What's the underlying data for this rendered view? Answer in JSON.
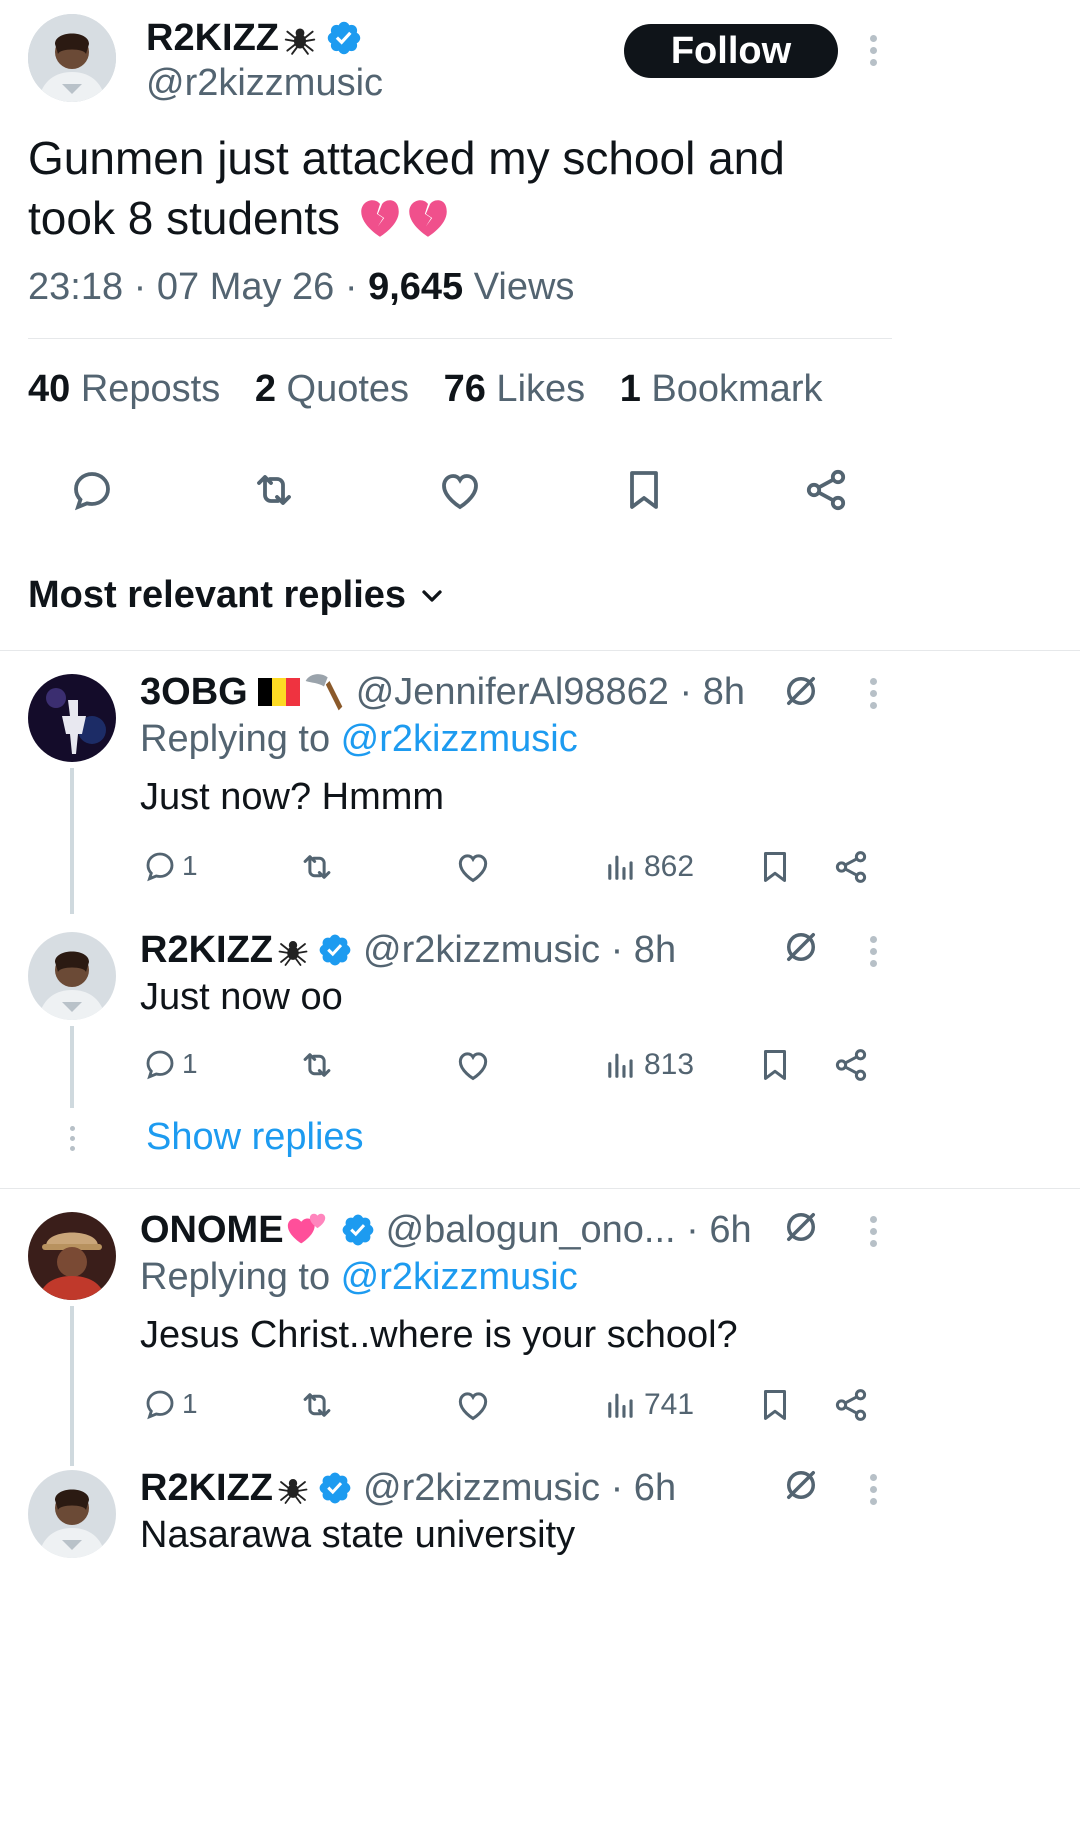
{
  "main_tweet": {
    "author_name": "R2KIZZ",
    "author_handle": "@r2kizzmusic",
    "follow_label": "Follow",
    "text_line1": "Gunmen just attacked my school and",
    "text_line2": "took 8 students",
    "emoji": "💔💔",
    "time": "23:18 · 07 May 26 · ",
    "views_count": "9,645",
    "views_label": " Views",
    "stats": {
      "reposts_num": "40",
      "reposts_label": " Reposts",
      "quotes_num": "2",
      "quotes_label": " Quotes",
      "likes_num": "76",
      "likes_label": " Likes",
      "bookmarks_num": "1",
      "bookmarks_label": " Bookmark"
    }
  },
  "replies_sort_label": "Most relevant replies",
  "replies": [
    {
      "name": "3OBG",
      "name_emoji": "🇧🇪",
      "handle": "@JenniferAl98862 · 8h",
      "replying_prefix": "Replying to ",
      "replying_to": "@r2kizzmusic",
      "text": "Just now? Hmmm",
      "reply_count": "1",
      "views": "862"
    },
    {
      "name": "R2KIZZ",
      "handle": "@r2kizzmusic · 8h",
      "text": "Just now oo",
      "reply_count": "1",
      "views": "813",
      "show_replies": "Show replies"
    },
    {
      "name": "ONOME",
      "name_emoji": "💕",
      "handle": "@balogun_ono... · 6h",
      "replying_prefix": "Replying to ",
      "replying_to": "@r2kizzmusic",
      "text": "Jesus Christ..where is your school?",
      "reply_count": "1",
      "views": "741"
    },
    {
      "name": "R2KIZZ",
      "handle": "@r2kizzmusic · 6h",
      "text": "Nasarawa state university"
    }
  ],
  "colors": {
    "accent": "#1d9bf0",
    "text": "#0f1419",
    "muted": "#536471"
  }
}
